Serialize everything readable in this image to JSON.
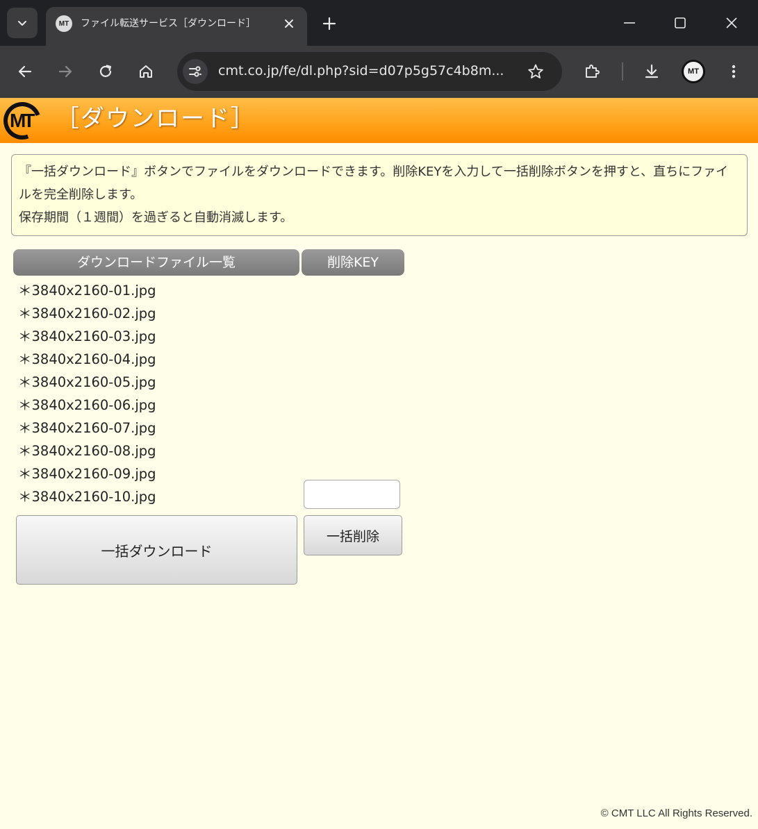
{
  "browser": {
    "tab": {
      "favicon_text": "MT",
      "title": "ファイル転送サービス［ダウンロード］"
    },
    "url": "cmt.co.jp/fe/dl.php?sid=d07p5g57c4b8m...",
    "profile_text": "MT"
  },
  "header": {
    "logo_text": "MT",
    "title": "［ダウンロード］"
  },
  "notice": {
    "line1": "『一括ダウンロード』ボタンでファイルをダウンロードできます。削除KEYを入力して一括削除ボタンを押すと、直ちにファイルを完全削除します。",
    "line2": "保存期間（１週間）を過ぎると自動消滅します。"
  },
  "columns": {
    "files": "ダウンロードファイル一覧",
    "delete_key": "削除KEY"
  },
  "files": [
    "＊3840x2160-01.jpg",
    "＊3840x2160-02.jpg",
    "＊3840x2160-03.jpg",
    "＊3840x2160-04.jpg",
    "＊3840x2160-05.jpg",
    "＊3840x2160-06.jpg",
    "＊3840x2160-07.jpg",
    "＊3840x2160-08.jpg",
    "＊3840x2160-09.jpg",
    "＊3840x2160-10.jpg"
  ],
  "delete_key_input": {
    "value": "",
    "placeholder": ""
  },
  "buttons": {
    "download_all": "一括ダウンロード",
    "delete_all": "一括削除"
  },
  "footer": "© CMT LLC All Rights Reserved.",
  "colors": {
    "header_orange": "#ffa41d",
    "page_bg": "#fefee9",
    "notice_bg": "#ffffdc",
    "column_header_gray": "#8a8a8a"
  },
  "icons": [
    "tab-search-icon",
    "close-icon",
    "plus-icon",
    "minimize-icon",
    "maximize-icon",
    "back-icon",
    "forward-icon",
    "reload-icon",
    "home-icon",
    "site-info-icon",
    "star-icon",
    "extensions-icon",
    "download-icon",
    "more-icon"
  ]
}
